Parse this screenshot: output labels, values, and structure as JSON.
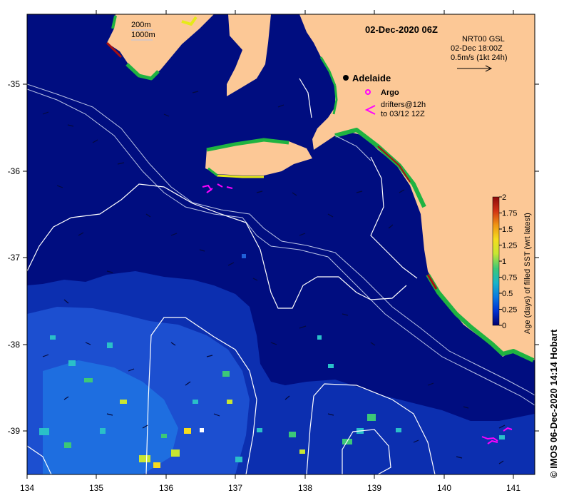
{
  "map": {
    "title": "02-Dec-2020 06Z",
    "product": "NRT00 GSL",
    "product_time": "02-Dec 18:00Z",
    "vector_scale_label": "0.5m/s (1kt 24h)",
    "city": "Adelaide",
    "depth_legend": [
      "200m",
      "1000m"
    ],
    "argo_label": "Argo",
    "drifters_label_1": "drifters@12h",
    "drifters_label_2": "to 03/12 12Z",
    "credit": "© IMOS 06-Dec-2020 14:14 Hobart",
    "colors": {
      "ocean": "#000d80",
      "land": "#fcc896",
      "coast_green": "#1fb341",
      "coast_yellow": "#e6ea18",
      "coast_red": "#a80f0f",
      "argo": "#ff00ff",
      "drifter": "#ff00ff",
      "isobath": "#b9c3e6",
      "contour": "#ffffff"
    }
  },
  "axes": {
    "x_ticks": [
      "134",
      "135",
      "136",
      "137",
      "138",
      "139",
      "140",
      "141"
    ],
    "y_ticks": [
      "-35",
      "-36",
      "-37",
      "-38",
      "-39"
    ]
  },
  "colorbar": {
    "label": "Age (days) of filled SST (wrt latest)",
    "ticks": [
      "2",
      "1.75",
      "1.5",
      "1.25",
      "1",
      "0.75",
      "0.5",
      "0.25",
      "0"
    ],
    "range": [
      0,
      2
    ],
    "stops": [
      "#00006e",
      "#0030d0",
      "#0a78e0",
      "#18b4c8",
      "#3cc878",
      "#c8e632",
      "#f5dc1e",
      "#f09614",
      "#d23214",
      "#8c0a0a"
    ]
  }
}
